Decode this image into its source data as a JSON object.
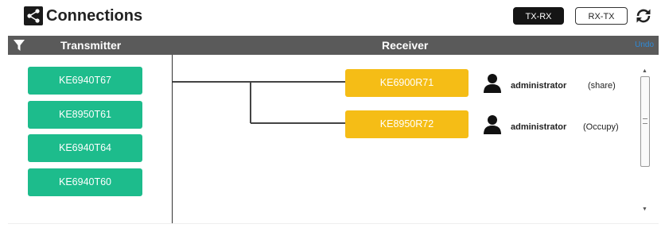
{
  "header": {
    "title": "Connections",
    "tx_rx_label": "TX-RX",
    "rx_tx_label": "RX-TX"
  },
  "columns": {
    "transmitter": "Transmitter",
    "receiver": "Receiver",
    "undo": "Undo"
  },
  "transmitters": [
    {
      "label": "KE6940T67"
    },
    {
      "label": "KE8950T61"
    },
    {
      "label": "KE6940T64"
    },
    {
      "label": "KE6940T60"
    }
  ],
  "receivers": [
    {
      "label": "KE6900R71",
      "user": "administrator",
      "mode": "(share)"
    },
    {
      "label": "KE8950R72",
      "user": "administrator",
      "mode": "(Occupy)"
    }
  ],
  "colors": {
    "transmitter": "#1dbc8c",
    "receiver": "#f5bd16",
    "header_bar": "#5a5a5a",
    "undo_link": "#2e8ad8"
  },
  "icons": [
    "share-icon",
    "refresh-icon",
    "filter-icon",
    "user-icon"
  ]
}
